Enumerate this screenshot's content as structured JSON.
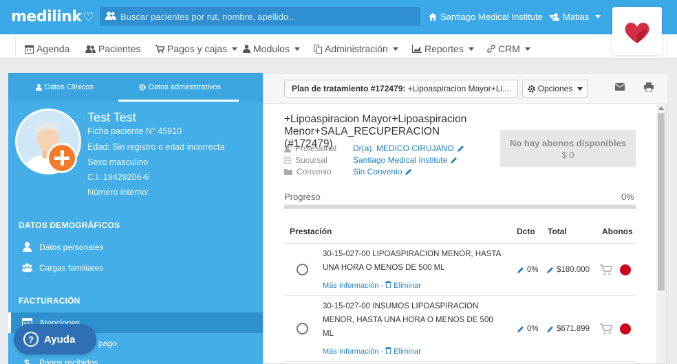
{
  "brand": {
    "logo_text": "medilink"
  },
  "search": {
    "placeholder": "Buscar pacientes por rut, nombre, apellido..."
  },
  "topnav": {
    "institution": "Santiago Medical Institute",
    "user": "Matias"
  },
  "menu": {
    "items": [
      {
        "label": "Agenda",
        "icon": "calendar-icon",
        "has_caret": false
      },
      {
        "label": "Pacientes",
        "icon": "users-icon",
        "has_caret": false
      },
      {
        "label": "Pagos y cajas",
        "icon": "cart-icon",
        "has_caret": true
      },
      {
        "label": "Modulos",
        "icon": "user-md-icon",
        "has_caret": true
      },
      {
        "label": "Administración",
        "icon": "copy-icon",
        "has_caret": true
      },
      {
        "label": "Reportes",
        "icon": "chart-icon",
        "has_caret": true
      },
      {
        "label": "CRM",
        "icon": "link-icon",
        "has_caret": true
      }
    ]
  },
  "left": {
    "tabs": [
      {
        "label": "Datos Clínicos",
        "icon": "user-md-icon",
        "active": false
      },
      {
        "label": "Datos administrativos",
        "icon": "gear-icon",
        "active": true
      }
    ],
    "patient": {
      "name": "Test Test",
      "ficha": "Ficha paciente N° 45910",
      "edad": "Edad: Sin registro o edad incorrecta",
      "sexo": "Sexo masculino",
      "ci": "C.I. 19429206-6",
      "interno": "Número interno:"
    },
    "sections": {
      "demograficos": "DATOS DEMOGRÁFICOS",
      "facturacion": "FACTURACIÓN"
    },
    "items": {
      "personales": "Datos personales",
      "cargas": "Cargas familiares",
      "atenciones": "Atenciones",
      "presupuestos": "Presupuestos y pago",
      "pagos": "Pagos recibidos"
    }
  },
  "help": {
    "label": "Ayuda"
  },
  "plan": {
    "button_bold": "Plan de tratamiento #172479:",
    "button_rest": " +Lipoaspiracion Mayor+Li...",
    "options_label": "Opciones",
    "title": "+Lipoaspiracion Mayor+Lipoaspiracion Menor+SALA_RECUPERACION (#172479)",
    "profesional_label": "Profesional",
    "profesional_value": "Dr(a). MEDICO CIRUJANO",
    "sucursal_label": "Sucursal",
    "sucursal_value": "Santiago Medical Institute",
    "convenio_label": "Convenio",
    "convenio_value": "Sin Convenio",
    "abonos_title": "No hay abonos disponibles",
    "abonos_value": "$ 0",
    "progreso_label": "Progreso",
    "progreso_pct": "0%",
    "progreso_fraction": 0
  },
  "table": {
    "headers": {
      "prestacion": "Prestación",
      "dcto": "Dcto",
      "total": "Total",
      "abonos": "Abonos"
    },
    "rows": [
      {
        "desc": "30-15-027-00 LIPOASPIRACION MENOR, HASTA UNA HORA O MENOS DE 500 ML",
        "mas_info": "Más Información",
        "eliminar": "Eliminar",
        "dcto": "0%",
        "total": "$180.000"
      },
      {
        "desc": "30-15-027-00 INSUMOS LIPOASPIRACION MENOR, HASTA UNA HORA O MENOS DE 500 ML",
        "mas_info": "Más Información",
        "eliminar": "Eliminar",
        "dcto": "0%",
        "total": "$671.899"
      }
    ]
  },
  "colors": {
    "brand_blue": "#3ba9e8",
    "status_red": "#d0021b",
    "help_blue": "#2f6fb5",
    "badge_orange": "#f47a2b"
  }
}
